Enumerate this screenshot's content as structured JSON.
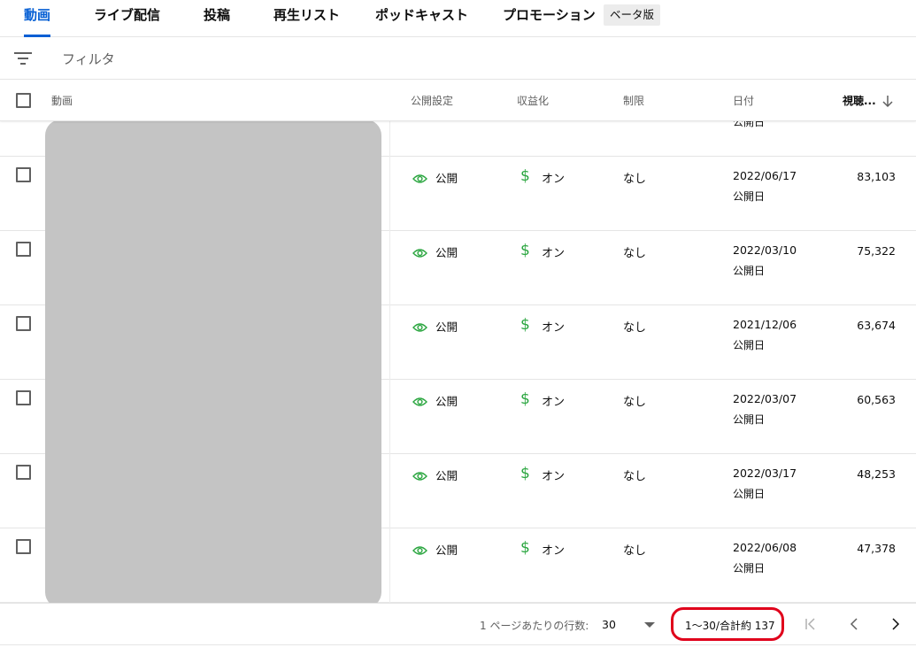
{
  "tabs": [
    {
      "label": "動画"
    },
    {
      "label": "ライブ配信"
    },
    {
      "label": "投稿"
    },
    {
      "label": "再生リスト"
    },
    {
      "label": "ポッドキャスト"
    },
    {
      "label": "プロモーション"
    }
  ],
  "beta_badge": "ベータ版",
  "filter": {
    "placeholder": "フィルタ",
    "icon": "filter-icon"
  },
  "table": {
    "headers": {
      "video": "動画",
      "visibility": "公開設定",
      "monetization": "収益化",
      "restrictions": "制限",
      "date": "日付",
      "views": "視聴..."
    },
    "partial_row": {
      "date_sub": "公開日"
    },
    "rows": [
      {
        "visibility": "公開",
        "monetization": "オン",
        "restrictions": "なし",
        "date": "2022/06/17",
        "date_sub": "公開日",
        "views": "83,103"
      },
      {
        "visibility": "公開",
        "monetization": "オン",
        "restrictions": "なし",
        "date": "2022/03/10",
        "date_sub": "公開日",
        "views": "75,322"
      },
      {
        "visibility": "公開",
        "monetization": "オン",
        "restrictions": "なし",
        "date": "2021/12/06",
        "date_sub": "公開日",
        "views": "63,674"
      },
      {
        "visibility": "公開",
        "monetization": "オン",
        "restrictions": "なし",
        "date": "2022/03/07",
        "date_sub": "公開日",
        "views": "60,563"
      },
      {
        "visibility": "公開",
        "monetization": "オン",
        "restrictions": "なし",
        "date": "2022/03/17",
        "date_sub": "公開日",
        "views": "48,253"
      },
      {
        "visibility": "公開",
        "monetization": "オン",
        "restrictions": "なし",
        "date": "2022/06/08",
        "date_sub": "公開日",
        "views": "47,378"
      }
    ]
  },
  "pagination": {
    "rows_per_page_label": "1 ページあたりの行数:",
    "rows_per_page_value": "30",
    "range": "1〜30/合計約 137"
  },
  "colors": {
    "accent": "#065fd4",
    "monetization_green": "#2ba640",
    "highlight_red": "#e0001b"
  }
}
